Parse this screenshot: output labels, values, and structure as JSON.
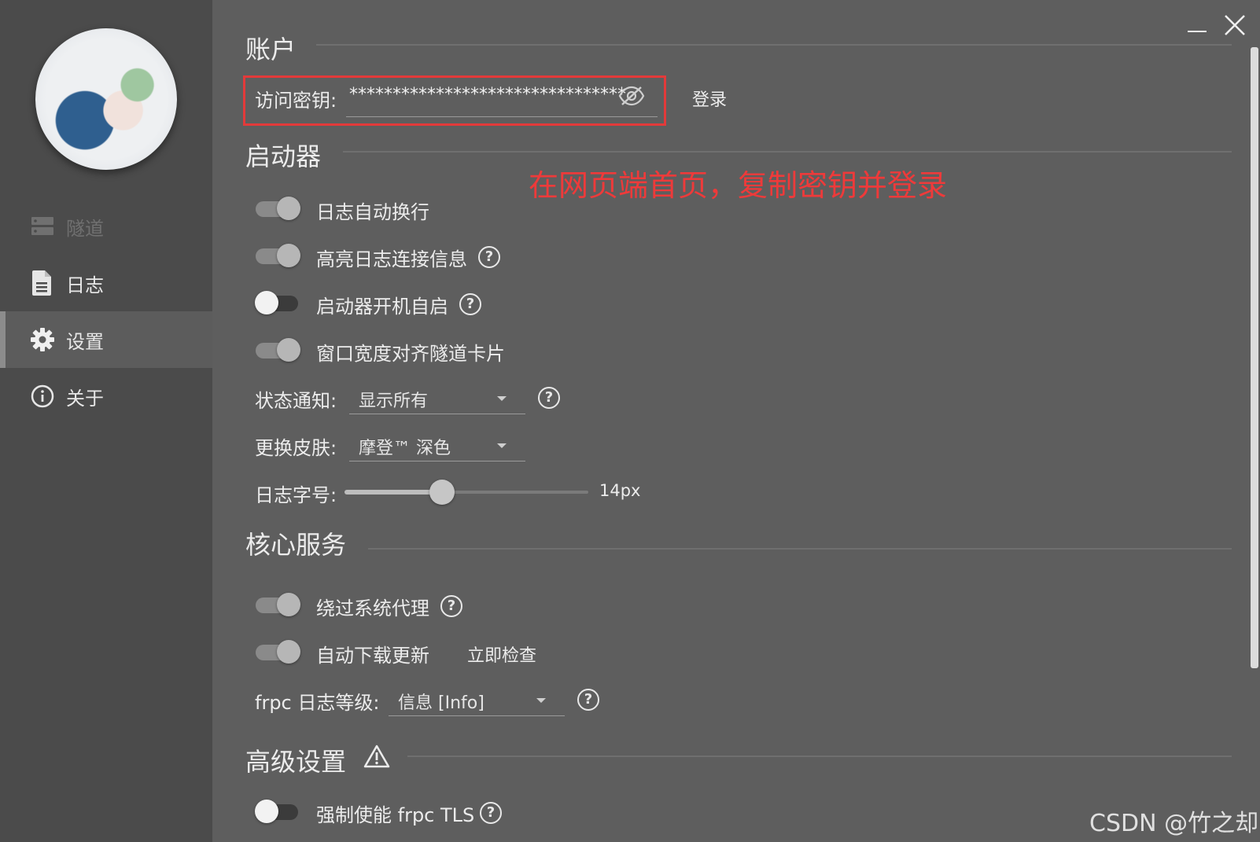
{
  "sidebar": {
    "items": [
      {
        "label": "隧道",
        "icon": "server-icon",
        "state": "disabled"
      },
      {
        "label": "日志",
        "icon": "document-icon",
        "state": "normal"
      },
      {
        "label": "设置",
        "icon": "gear-icon",
        "state": "active"
      },
      {
        "label": "关于",
        "icon": "info-icon",
        "state": "normal"
      }
    ]
  },
  "window": {
    "minimize": "minimize-icon",
    "close": "close-icon"
  },
  "account": {
    "title": "账户",
    "key_label": "访问密钥:",
    "key_value": "********************************",
    "login_label": "登录",
    "annotation": "在网页端首页，复制密钥并登录"
  },
  "launcher": {
    "title": "启动器",
    "toggles": [
      {
        "label": "日志自动换行",
        "on": true,
        "help": false
      },
      {
        "label": "高亮日志连接信息",
        "on": true,
        "help": true
      },
      {
        "label": "启动器开机自启",
        "on": false,
        "help": true
      },
      {
        "label": "窗口宽度对齐隧道卡片",
        "on": true,
        "help": false
      }
    ],
    "notify_label": "状态通知:",
    "notify_value": "显示所有",
    "skin_label": "更换皮肤:",
    "skin_value": "摩登™ 深色",
    "font_label": "日志字号:",
    "font_value": "14px",
    "font_slider_fraction": 0.4
  },
  "core": {
    "title": "核心服务",
    "bypass_label": "绕过系统代理",
    "bypass_on": true,
    "autoupdate_label": "自动下载更新",
    "autoupdate_on": true,
    "check_now": "立即检查",
    "loglevel_label": "frpc 日志等级:",
    "loglevel_value": "信息 [Info]"
  },
  "advanced": {
    "title": "高级设置",
    "tls_label": "强制使能 frpc TLS",
    "tls_on": false
  },
  "watermark": "CSDN @竹之却",
  "colors": {
    "annotation": "#ee3a3a",
    "background": "#5e5e5e",
    "sidebar": "#4b4b4b"
  }
}
